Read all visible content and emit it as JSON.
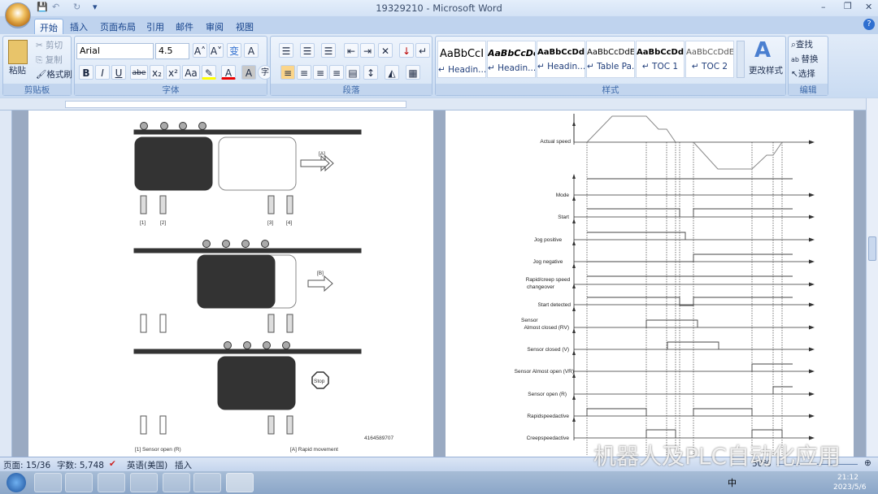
{
  "window": {
    "title": "19329210 - Microsoft Word",
    "minimize": "–",
    "restore": "❐",
    "close": "✕",
    "help": "?"
  },
  "quick_access": {
    "save": "💾",
    "undo": "↶",
    "redo": "↻",
    "customize": "▾"
  },
  "tabs": [
    "开始",
    "插入",
    "页面布局",
    "引用",
    "邮件",
    "审阅",
    "视图"
  ],
  "clipboard": {
    "paste": "粘贴",
    "cut": "剪切",
    "copy": "复制",
    "format_painter": "格式刷",
    "label": "剪贴板"
  },
  "font": {
    "name": "Arial",
    "size": "4.5",
    "label": "字体",
    "bold": "B",
    "italic": "I",
    "underline": "U",
    "strike": "abe",
    "sub": "x₂",
    "sup": "x²",
    "case": "Aa",
    "grow": "A˄",
    "shrink": "A˅",
    "color_a": "A",
    "shade": "A",
    "enclose": "字",
    "phonetic": "变",
    "border": "A"
  },
  "paragraph": {
    "label": "段落"
  },
  "styles": {
    "label": "样式",
    "change": "更改样式",
    "items": [
      {
        "preview": "AaBbCcI",
        "name": "↵ Headin..."
      },
      {
        "preview": "AaBbCcDc",
        "name": "↵ Headin..."
      },
      {
        "preview": "AaBbCcDdE",
        "name": "↵ Headin..."
      },
      {
        "preview": "AaBbCcDdE",
        "name": "↵ Table Pa..."
      },
      {
        "preview": "AaBbCcDdE",
        "name": "↵ TOC 1"
      },
      {
        "preview": "AaBbCcDdEe",
        "name": "↵ TOC 2"
      }
    ]
  },
  "editing": {
    "label": "编辑",
    "find": "查找",
    "replace": "替换",
    "select": "选择"
  },
  "left_page": {
    "labels": {
      "l1": "[1]",
      "l2": "[2]",
      "l3": "[3]",
      "l4": "[4]",
      "A": "[A]",
      "B": "[B]",
      "stop": "Stop"
    },
    "figure_id": "4164589707",
    "legend_1": "[1]   Sensor open (R)",
    "legend_A": "[A] Rapid movement"
  },
  "right_page": {
    "signals": [
      "Actual speed",
      "Mode",
      "Start",
      "Jog  positive",
      "Jog  negative",
      "Rapid/creep  speed",
      "changeover",
      "Start detected",
      "Sensor",
      "Almost closed (RV)",
      "Sensor closed (V)",
      "Sensor Almost open (VR)",
      "Sensor open (R)",
      "Rapidspeedactive",
      "Creepspeedactive"
    ]
  },
  "status": {
    "page": "页面: 15/36",
    "words": "字数: 5,748",
    "language": "英语(美国)",
    "mode": "插入",
    "zoom": "50%"
  },
  "watermark": "机器人及PLC自动化应用",
  "taskbar": {
    "time": "21:12",
    "date": "2023/5/6",
    "ime": "中"
  }
}
